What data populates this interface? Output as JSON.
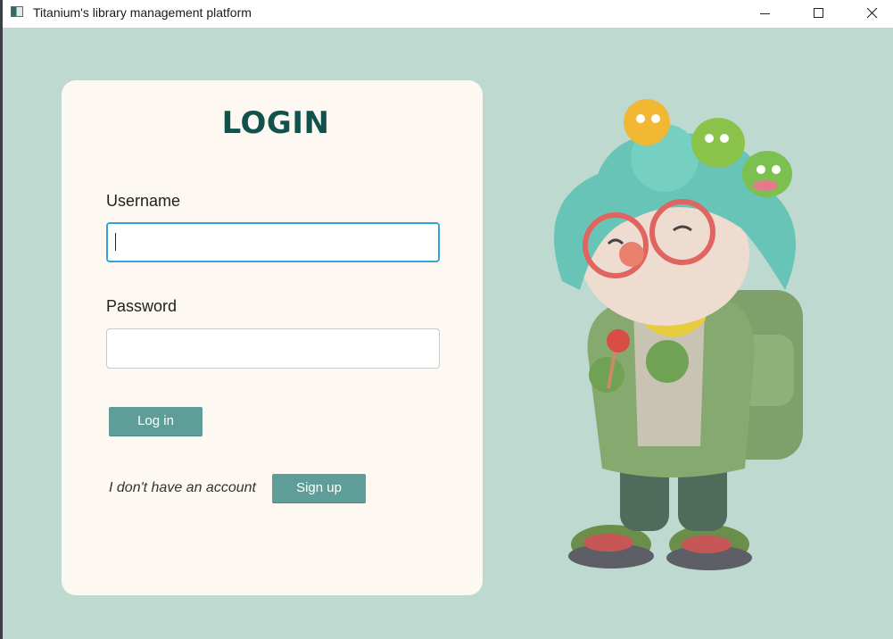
{
  "window": {
    "title": "Titanium's library management platform",
    "icon": "app-icon",
    "controls": [
      "minimize-icon",
      "maximize-icon",
      "close-icon"
    ]
  },
  "login": {
    "heading": "LOGIN",
    "username_label": "Username",
    "username_value": "",
    "password_label": "Password",
    "password_value": "",
    "login_button": "Log in",
    "no_account_text": "I don't have an account",
    "signup_button": "Sign up"
  },
  "colors": {
    "background": "#bed9d0",
    "card": "#fdf8f1",
    "accent": "#5f9e98",
    "heading": "#12524c",
    "focus_border": "#2fa7d6"
  },
  "illustration": {
    "icon": "mascot-illustration"
  }
}
